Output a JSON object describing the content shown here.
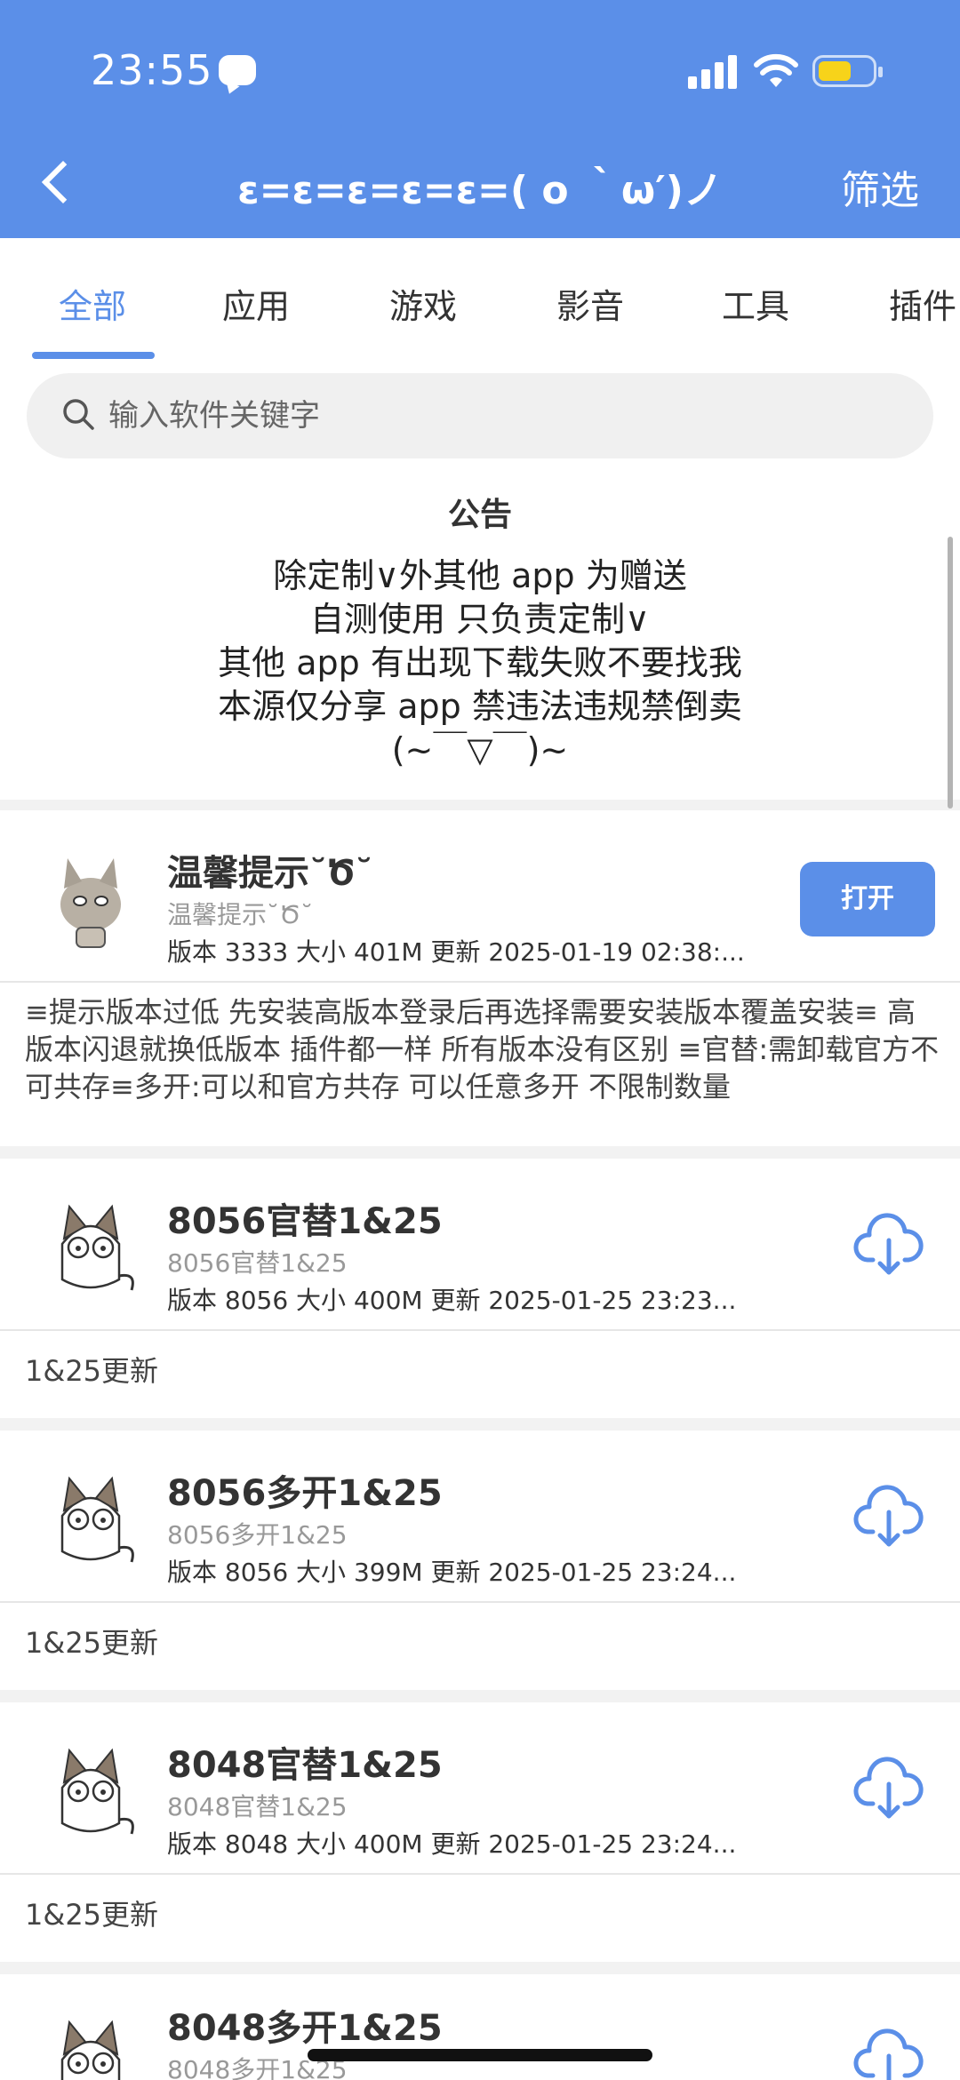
{
  "status_bar": {
    "time": "23:55"
  },
  "header": {
    "title": "ε=ε=ε=ε=ε=( o ｀ω′)ノ",
    "filter_label": "筛选"
  },
  "tabs": [
    {
      "label": "全部",
      "active": true
    },
    {
      "label": "应用"
    },
    {
      "label": "游戏"
    },
    {
      "label": "影音"
    },
    {
      "label": "工具"
    },
    {
      "label": "插件"
    }
  ],
  "search": {
    "placeholder": "输入软件关键字"
  },
  "notice": {
    "title": "公告",
    "lines": [
      "除定制∨外其他 app 为赠送",
      "自测使用 只负责定制∨",
      "其他 app 有出现下载失败不要找我",
      "本源仅分享 app 禁违法违规禁倒卖",
      "(~￣▽￣)~"
    ]
  },
  "apps": [
    {
      "name": "温馨提示˘Ծ˘",
      "subtitle": "温馨提示˘Ծ˘",
      "meta": "版本 3333   大小 401M   更新 2025-01-19 02:38:...",
      "action": "打开",
      "description": "≡提示版本过低 先安装高版本登录后再选择需要安装版本覆盖安装≡ 高版本闪退就换低版本 插件都一样 所有版本没有区别 ≡官替:需卸载官方不可共存≡多开:可以和官方共存 可以任意多开 不限制数量"
    },
    {
      "name": "8056官替1&25",
      "subtitle": "8056官替1&25",
      "meta": "版本 8056   大小 400M   更新 2025-01-25 23:23...",
      "action": "download",
      "description": "1&25更新"
    },
    {
      "name": "8056多开1&25",
      "subtitle": "8056多开1&25",
      "meta": "版本 8056   大小 399M   更新 2025-01-25 23:24...",
      "action": "download",
      "description": "1&25更新"
    },
    {
      "name": "8048官替1&25",
      "subtitle": "8048官替1&25",
      "meta": "版本 8048   大小 400M   更新 2025-01-25 23:24...",
      "action": "download",
      "description": "1&25更新"
    },
    {
      "name": "8048多开1&25",
      "subtitle": "8048多开1&25",
      "meta": "",
      "action": "download",
      "description": ""
    }
  ],
  "colors": {
    "accent": "#5b8fe8",
    "battery": "#f7d31a"
  }
}
